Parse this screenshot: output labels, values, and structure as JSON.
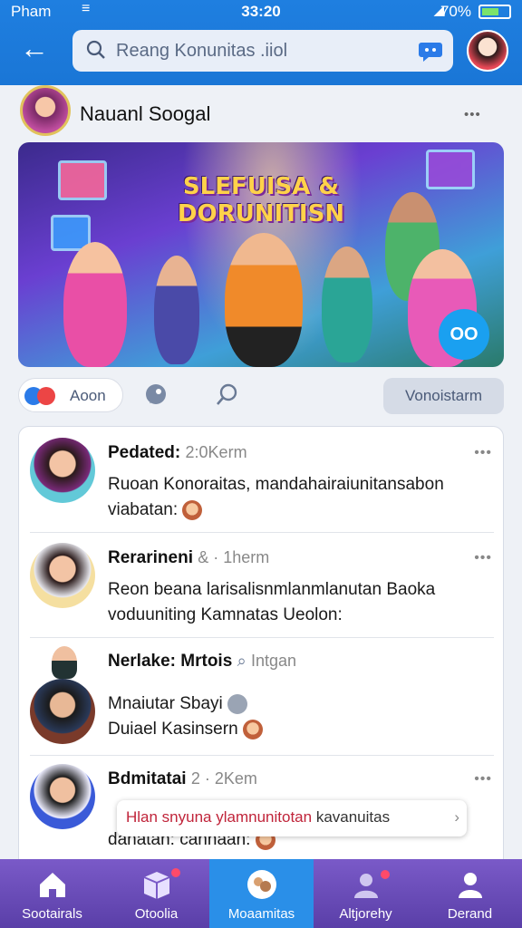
{
  "status": {
    "carrier": "Pham",
    "time": "33:20",
    "battery": "70%"
  },
  "header": {
    "search_placeholder": "Reang Konunitas .iiol"
  },
  "community": {
    "name": "Nauanl Soogal",
    "more": "•••"
  },
  "banner": {
    "title_line1": "SLEFUISA &",
    "title_line2": "DORUNITISN",
    "play_label": "OO"
  },
  "actions": {
    "react_label": "Aoon",
    "join_label": "Vonoistarm"
  },
  "posts": [
    {
      "name": "Pedated:",
      "meta": "2:0Kerm",
      "text_line1": "Ruoan Konoraitas, mandahairaiunitansabon",
      "text_line2": "viabatan:"
    },
    {
      "name": "Rerarineni",
      "meta": "& · 1herm",
      "text_line1": "Reon beana larisalisnmlanmlanutan Baoka",
      "text_line2": "voduuniting Kamnatas Ueolon:"
    },
    {
      "name": "Nerlake: Mrtois",
      "meta": "Intgan",
      "text_line1": "Mnaiutar Sbayi",
      "text_line2": "Duiael Kasinsern"
    },
    {
      "name": "Bdmitatai",
      "meta": "2 · 2Kem",
      "text_line1": "",
      "text_line2": "danatan: cannaan:"
    }
  ],
  "toast": {
    "highlight": "Hlan snyuna ylamnunitotan",
    "rest": "kavanuitas"
  },
  "nav": [
    {
      "label": "Sootairals"
    },
    {
      "label": "Otoolia"
    },
    {
      "label": "Moaamitas"
    },
    {
      "label": "Altjorehy"
    },
    {
      "label": "Derand"
    }
  ],
  "colors": {
    "primary": "#1f7fe0",
    "nav_bg": "#6a4ab8",
    "nav_active": "#2a8fe8"
  }
}
